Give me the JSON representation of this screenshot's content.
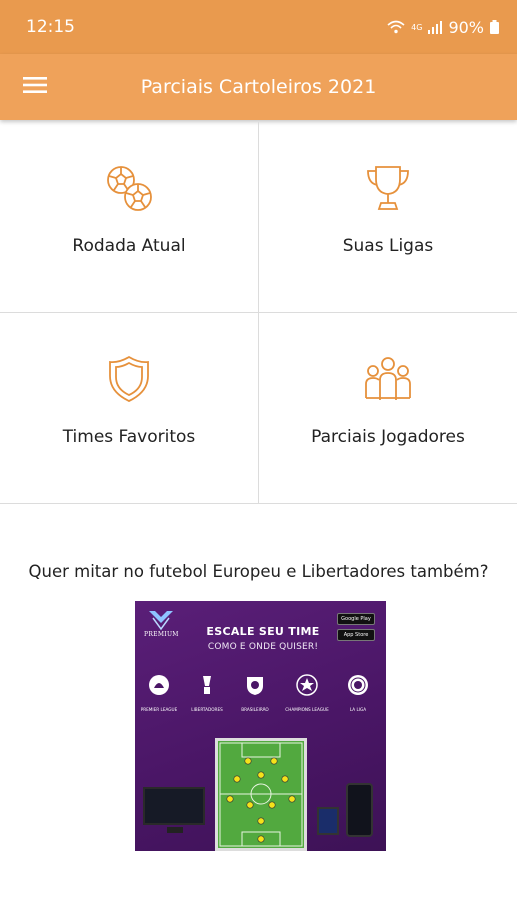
{
  "status_bar": {
    "time": "12:15",
    "network": "4G",
    "battery": "90%"
  },
  "app_bar": {
    "title": "Parciais Cartoleiros 2021",
    "menu_icon": "hamburger-menu-icon"
  },
  "tiles": [
    {
      "label": "Rodada Atual",
      "icon": "soccer-balls-icon"
    },
    {
      "label": "Suas Ligas",
      "icon": "trophy-icon"
    },
    {
      "label": "Times Favoritos",
      "icon": "shield-icon"
    },
    {
      "label": "Parciais Jogadores",
      "icon": "players-group-icon"
    }
  ],
  "promo": {
    "question": "Quer mitar no futebol Europeu e Libertadores também?"
  },
  "ad": {
    "brand": "PREMIUM",
    "headline": "ESCALE SEU TIME",
    "subline": "COMO E ONDE QUISER!",
    "store_badges": [
      "Google Play",
      "App Store"
    ],
    "leagues": [
      "PREMIER LEAGUE",
      "LIBERTADORES",
      "BRASILEIRÃO",
      "CHAMPIONS LEAGUE",
      "LA LIGA"
    ]
  },
  "colors": {
    "status_bar": "#e99a4e",
    "app_bar": "#efa25a",
    "accent_icon": "#e6913c",
    "ad_background": "#4a1666"
  }
}
